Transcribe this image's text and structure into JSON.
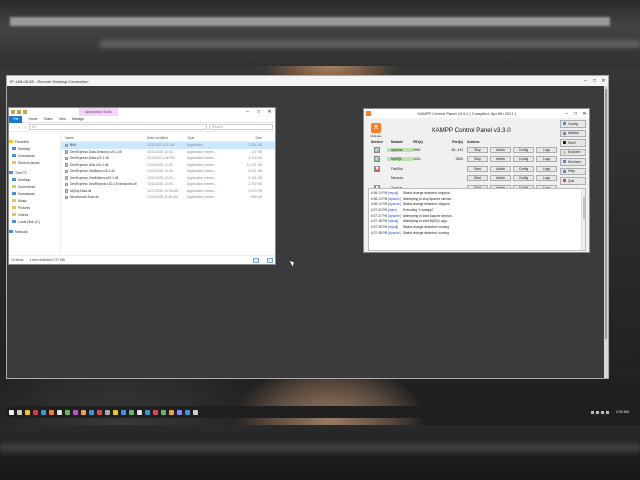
{
  "remote_desktop": {
    "title": "IP-1A5-08-85 - Remote Desktop Connection",
    "btn_min": "–",
    "btn_max": "□",
    "btn_close": "✕"
  },
  "explorer": {
    "context_tab": "Application Tools",
    "btn_min": "–",
    "btn_max": "□",
    "btn_close": "✕",
    "ribbon_tabs": [
      "File",
      "Home",
      "Share",
      "View",
      "Manage"
    ],
    "nav_back": "‹",
    "nav_fwd": "›",
    "nav_up": "↑",
    "address": "« ›",
    "search_placeholder": "Search",
    "nav_items": [
      "Favorites",
      "Desktop",
      "Downloads",
      "Recent places",
      "This PC",
      "Desktop",
      "Documents",
      "Downloads",
      "Music",
      "Pictures",
      "Videos",
      "Local Disk (C:)",
      "Network"
    ],
    "columns": {
      "name": "Name",
      "date": "Date modified",
      "type": "Type",
      "size": "Size"
    },
    "files": [
      {
        "name": "Bin1",
        "date": "11/3/2020 4:21 AM",
        "type": "Application",
        "size": "2,281 KB"
      },
      {
        "name": "DevExpress.Data.Desktop.v20.1.dll",
        "date": "10/11/2020 12:30...",
        "type": "Application extens...",
        "size": "107 KB"
      },
      {
        "name": "DevExpress.Data.v20.1.dll",
        "date": "9/11/2020 4:46 PM",
        "type": "Application extens...",
        "size": "4,318 KB"
      },
      {
        "name": "DevExpress.Utils.v20.1.dll",
        "date": "10/11/2020 12:30...",
        "type": "Application extens...",
        "size": "11,331 KB"
      },
      {
        "name": "DevExpress.XtraBars.v20.1.dll",
        "date": "10/11/2020 12:30...",
        "type": "Application extens...",
        "size": "8,631 KB"
      },
      {
        "name": "DevExpress.XtraEditors.v20.1.dll",
        "date": "10/11/2020 12:30...",
        "type": "Application extens...",
        "size": "8,341 KB"
      },
      {
        "name": "DevExpress.XtraReports.v20.1.Extensions.dll",
        "date": "10/11/2020 12:30...",
        "type": "Application extens...",
        "size": "2,750 KB"
      },
      {
        "name": "MySql.Data.dll",
        "date": "11/27/2020 10:46 AM",
        "type": "Application extens...",
        "size": "3,020 KB"
      },
      {
        "name": "Newtonsoft.Json.dll",
        "date": "10/11/2020 11:46 AM",
        "type": "Application extens...",
        "size": "688 KB"
      }
    ],
    "status_items": "10 items",
    "status_selected": "1 item selected  2.22 MB"
  },
  "xampp": {
    "title": "XAMPP Control Panel v3.3.0   [ Compiled: Apr 6th 2021 ]",
    "btn_min": "–",
    "btn_max": "□",
    "btn_close": "✕",
    "heading": "XAMPP Control Panel v3.3.0",
    "logo_caption": "Modules",
    "logo_glyph": "X",
    "columns": {
      "service": "Service",
      "module": "Module",
      "pid": "PID(s)",
      "port": "Port(s)",
      "actions": "Actions"
    },
    "modules": [
      {
        "service": "✔",
        "service_state": "ok",
        "module": "Apache",
        "running": true,
        "pid": "5960",
        "port": "80, 443",
        "action": "Stop",
        "admin": "Admin",
        "config": "Config",
        "logs": "Logs"
      },
      {
        "service": "✔",
        "service_state": "ok",
        "module": "MySQL",
        "running": true,
        "pid": "1604",
        "port": "3306",
        "action": "Stop",
        "admin": "Admin",
        "config": "Config",
        "logs": "Logs"
      },
      {
        "service": "✖",
        "service_state": "no",
        "module": "FileZilla",
        "running": false,
        "pid": "",
        "port": "",
        "action": "Start",
        "admin": "Admin",
        "config": "Config",
        "logs": "Logs"
      },
      {
        "service": "",
        "service_state": "none",
        "module": "Mercury",
        "running": false,
        "pid": "",
        "port": "",
        "action": "Start",
        "admin": "Admin",
        "config": "Config",
        "logs": "Logs"
      },
      {
        "service": "✖",
        "service_state": "no",
        "module": "Tomcat",
        "running": false,
        "pid": "",
        "port": "",
        "action": "Start",
        "admin": "Admin",
        "config": "Config",
        "logs": "Logs"
      }
    ],
    "side_buttons": [
      "Config",
      "Netstat",
      "Shell",
      "Explorer",
      "Services",
      "Help",
      "Quit"
    ],
    "log": [
      {
        "time": "6:36:13 PM",
        "module": "[mysql]",
        "msg": "Status change detected: stopped"
      },
      {
        "time": "6:36:13 PM",
        "module": "[Apache]",
        "msg": "Attempting to stop Apache service..."
      },
      {
        "time": "6:36:14 PM",
        "module": "[Apache]",
        "msg": "Status change detected: stopped"
      },
      {
        "time": "6:37:33 PM",
        "module": "[main]",
        "msg": "Executing \"c:\\xampp\\\""
      },
      {
        "time": "6:37:37 PM",
        "module": "[Apache]",
        "msg": "Attempting to start Apache service..."
      },
      {
        "time": "6:37:38 PM",
        "module": "[mysql]",
        "msg": "Attempting to start MySQL app..."
      },
      {
        "time": "6:37:38 PM",
        "module": "[mysql]",
        "msg": "Status change detected: running"
      },
      {
        "time": "6:37:38 PM",
        "module": "[Apache]",
        "msg": "Status change detected: running"
      }
    ]
  },
  "taskbar": {
    "clock": "2:09 AM",
    "app_colors": [
      "#f5f5f5",
      "#cfcfcf",
      "#f0c419",
      "#d83b3b",
      "#3a96dd",
      "#fb7a24",
      "#e0e0e0",
      "#6bb26b",
      "#c74bd1",
      "#e8a33d",
      "#3a96dd",
      "#d84b4b",
      "#aaaaaa",
      "#f0c419",
      "#3a96dd",
      "#6bb26b",
      "#e0e0e0",
      "#3a96dd",
      "#d84b4b",
      "#6bb26b",
      "#e8a33d",
      "#8a8aff",
      "#3a96dd",
      "#cfcfcf"
    ]
  }
}
